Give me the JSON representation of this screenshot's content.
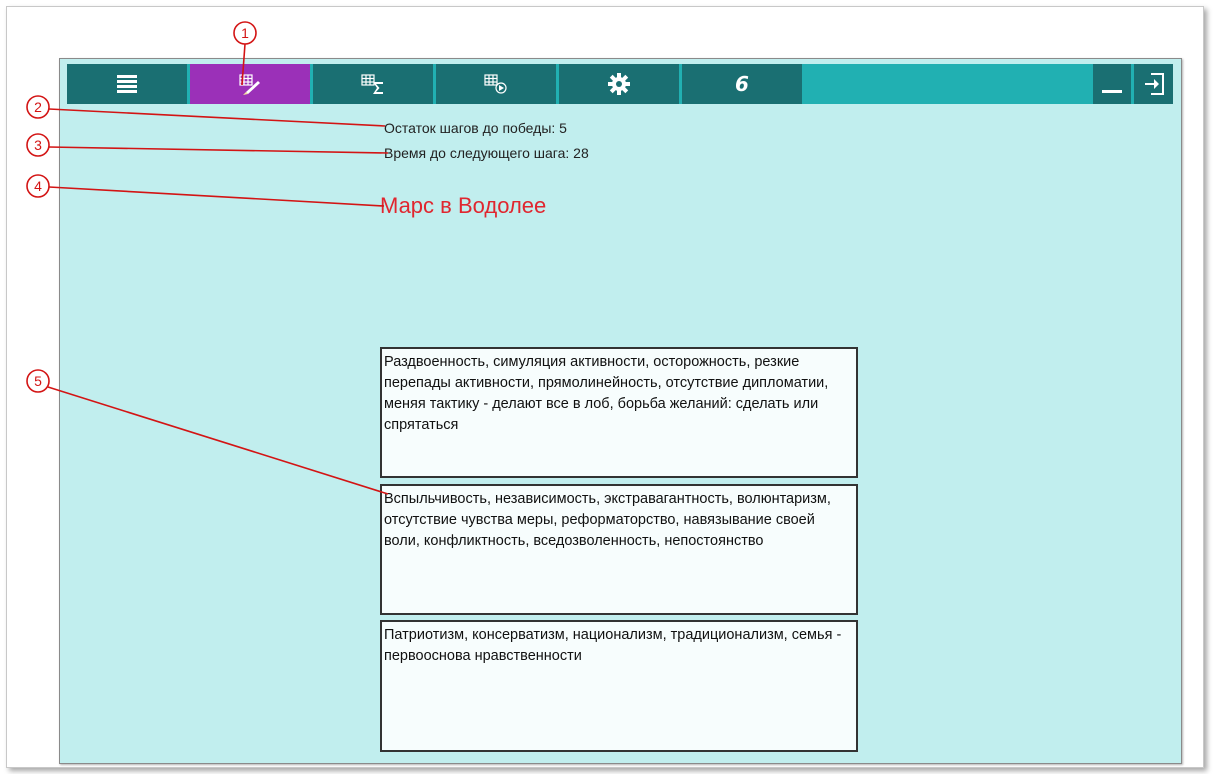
{
  "toolbar": {
    "buttons": [
      {
        "name": "menu-button",
        "icon": "list-icon",
        "active": false
      },
      {
        "name": "chart-edit-button",
        "icon": "grid-pencil-icon",
        "active": true
      },
      {
        "name": "chart-sum-button",
        "icon": "grid-sigma-icon",
        "active": false
      },
      {
        "name": "chart-view-button",
        "icon": "grid-arrow-icon",
        "active": false
      },
      {
        "name": "settings-button",
        "icon": "gear-icon",
        "active": false
      },
      {
        "name": "logo-button",
        "icon": "script-6-icon",
        "label": "6",
        "active": false
      }
    ],
    "minimize_icon": "minimize-icon",
    "exit_icon": "exit-icon",
    "active_color": "#9b30b8",
    "button_color": "#1a6f72",
    "bar_color": "#21b0b2"
  },
  "status": {
    "steps_left": "Остаток шагов до победы: 5",
    "time_to_next": "Время до следующего шага: 28"
  },
  "heading": "Марс в Водолее",
  "traits": [
    "Раздвоенность, симуляция активности, осторожность, резкие перепады активности, прямолинейность, отсутствие дипломатии, меняя тактику - делают все в лоб, борьба желаний: сделать или спрятаться",
    "Вспыльчивость, независимость, экстравагантность, волюнтаризм, отсутствие чувства меры, реформаторство, навязывание своей воли, конфликтность, вседозволенность, непостоянство",
    "Патриотизм, консерватизм, национализм, традиционализм, семья - первооснова нравственности"
  ],
  "callouts": [
    "1",
    "2",
    "3",
    "4",
    "5"
  ]
}
